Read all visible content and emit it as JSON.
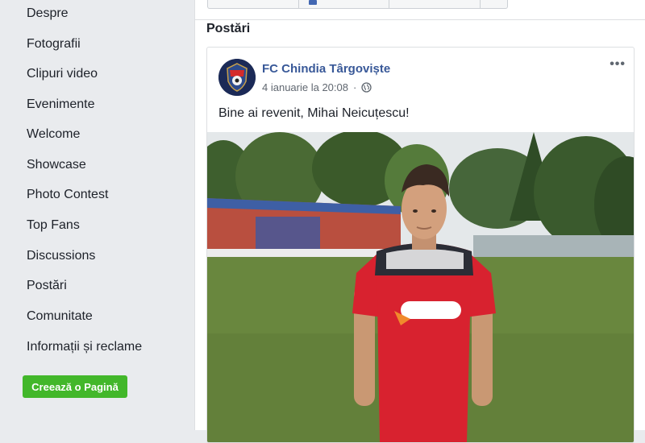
{
  "sidebar": {
    "items": [
      {
        "label": "Despre"
      },
      {
        "label": "Fotografii"
      },
      {
        "label": "Clipuri video"
      },
      {
        "label": "Evenimente"
      },
      {
        "label": "Welcome"
      },
      {
        "label": "Showcase"
      },
      {
        "label": "Photo Contest"
      },
      {
        "label": "Top Fans"
      },
      {
        "label": "Discussions"
      },
      {
        "label": "Postări"
      },
      {
        "label": "Comunitate"
      },
      {
        "label": "Informații și reclame"
      }
    ],
    "create_page_label": "Creează o Pagină"
  },
  "main": {
    "section_title": "Postări",
    "post": {
      "author": "FC Chindia Târgoviște",
      "timestamp": "4 ianuarie la 20:08",
      "text": "Bine ai revenit, Mihai Neicuțescu!",
      "more_icon": "more-horizontal-icon",
      "privacy_icon": "globe-icon"
    }
  },
  "colors": {
    "link": "#385898",
    "create_button": "#42b72a",
    "background": "#e9ebee"
  }
}
